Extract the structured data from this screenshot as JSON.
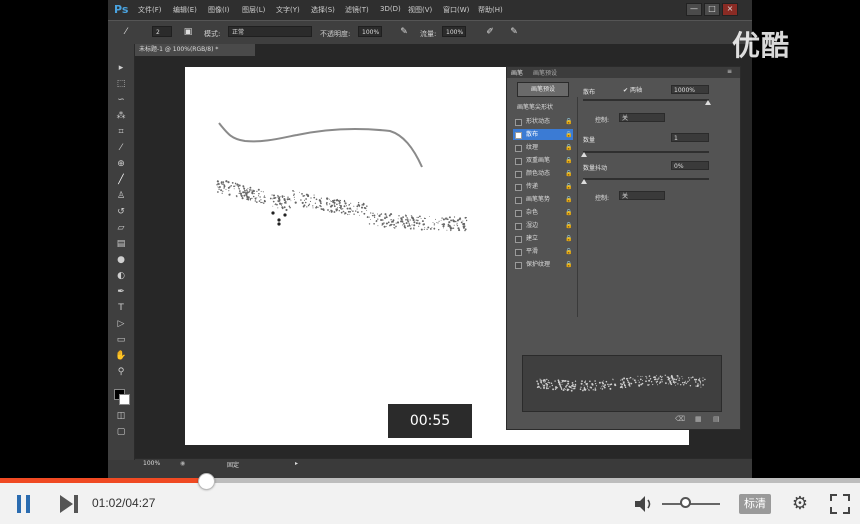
{
  "app": {
    "logo": "Ps",
    "menu": [
      "文件(F)",
      "编辑(E)",
      "图像(I)",
      "图层(L)",
      "文字(Y)",
      "选择(S)",
      "滤镜(T)",
      "3D(D)",
      "视图(V)",
      "窗口(W)",
      "帮助(H)"
    ],
    "window_controls": [
      "—",
      "□",
      "×"
    ]
  },
  "options_bar": {
    "brush_size": "2",
    "mode_label": "模式:",
    "mode_value": "正常",
    "opacity_label": "不透明度:",
    "opacity_value": "100%",
    "flow_label": "流量:",
    "flow_value": "100%"
  },
  "document": {
    "tab_title": "未标题-1 @ 100%(RGB/8) *",
    "zoom": "100%",
    "status_info": "固定"
  },
  "brush_panel": {
    "tabs": [
      "画笔",
      "画笔预设"
    ],
    "preset_button": "画笔预设",
    "list_title": "画笔笔尖形状",
    "items": [
      {
        "label": "形状动态",
        "checked": false
      },
      {
        "label": "散布",
        "checked": true
      },
      {
        "label": "纹理",
        "checked": false
      },
      {
        "label": "双重画笔",
        "checked": false
      },
      {
        "label": "颜色动态",
        "checked": false
      },
      {
        "label": "传递",
        "checked": false
      },
      {
        "label": "画笔笔势",
        "checked": false
      },
      {
        "label": "杂色",
        "checked": false
      },
      {
        "label": "湿边",
        "checked": false
      },
      {
        "label": "建立",
        "checked": false
      },
      {
        "label": "平滑",
        "checked": false
      },
      {
        "label": "保护纹理",
        "checked": false
      }
    ],
    "scatter_label": "散布",
    "both_axes_label": "两轴",
    "scatter_value": "1000%",
    "control_label": "控制:",
    "control_value": "关",
    "count_label": "数量",
    "count_value": "1",
    "count_jitter_label": "数量抖动",
    "count_jitter_value": "0%",
    "control2_value": "关"
  },
  "overlay": {
    "timestamp": "00:55",
    "watermark": "优酷"
  },
  "player": {
    "elapsed": "01:02",
    "duration": "04:27",
    "progress_fraction": 0.24,
    "volume_fraction": 0.4,
    "quality_label": "标清",
    "accent_color": "#f04a23"
  }
}
